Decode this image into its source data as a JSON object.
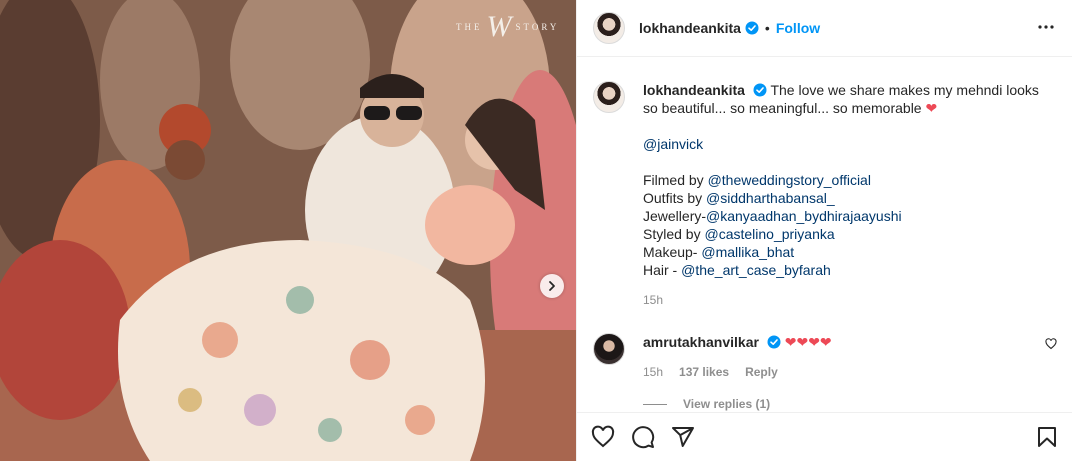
{
  "post": {
    "media": {
      "watermark_left": "THE",
      "watermark_mark": "W",
      "watermark_right": "STORY"
    },
    "header": {
      "username": "lokhandeankita",
      "separator": "•",
      "follow_label": "Follow"
    },
    "caption": {
      "username": "lokhandeankita",
      "text_line1": "The love we share makes my mehndi looks so beautiful... so meaningful... so memorable",
      "mention_jainvick": "@jainvick",
      "credits": [
        {
          "label": "Filmed by ",
          "handle": "@theweddingstory_official"
        },
        {
          "label": "Outfits by ",
          "handle": "@siddharthabansal_"
        },
        {
          "label": "Jewellery-",
          "handle": "@kanyaadhan_bydhirajaayushi"
        },
        {
          "label": "Styled by ",
          "handle": "@castelino_priyanka"
        },
        {
          "label": "Makeup- ",
          "handle": "@mallika_bhat"
        },
        {
          "label": "Hair - ",
          "handle": "@the_art_case_byfarah"
        }
      ],
      "time": "15h"
    },
    "comments": [
      {
        "username": "amrutakhanvilkar",
        "text": "❤❤❤❤",
        "time": "15h",
        "likes": "137 likes",
        "reply_label": "Reply",
        "view_replies": "View replies (1)"
      }
    ],
    "icons": {
      "more": "more-horizontal-icon",
      "like": "heart-icon",
      "comment": "comment-icon",
      "share": "paper-plane-icon",
      "save": "bookmark-icon",
      "next": "chevron-right-icon"
    },
    "colors": {
      "accent": "#0095f6",
      "mention": "#00376b",
      "heart": "#ed4956",
      "muted": "#8e8e8e"
    }
  }
}
